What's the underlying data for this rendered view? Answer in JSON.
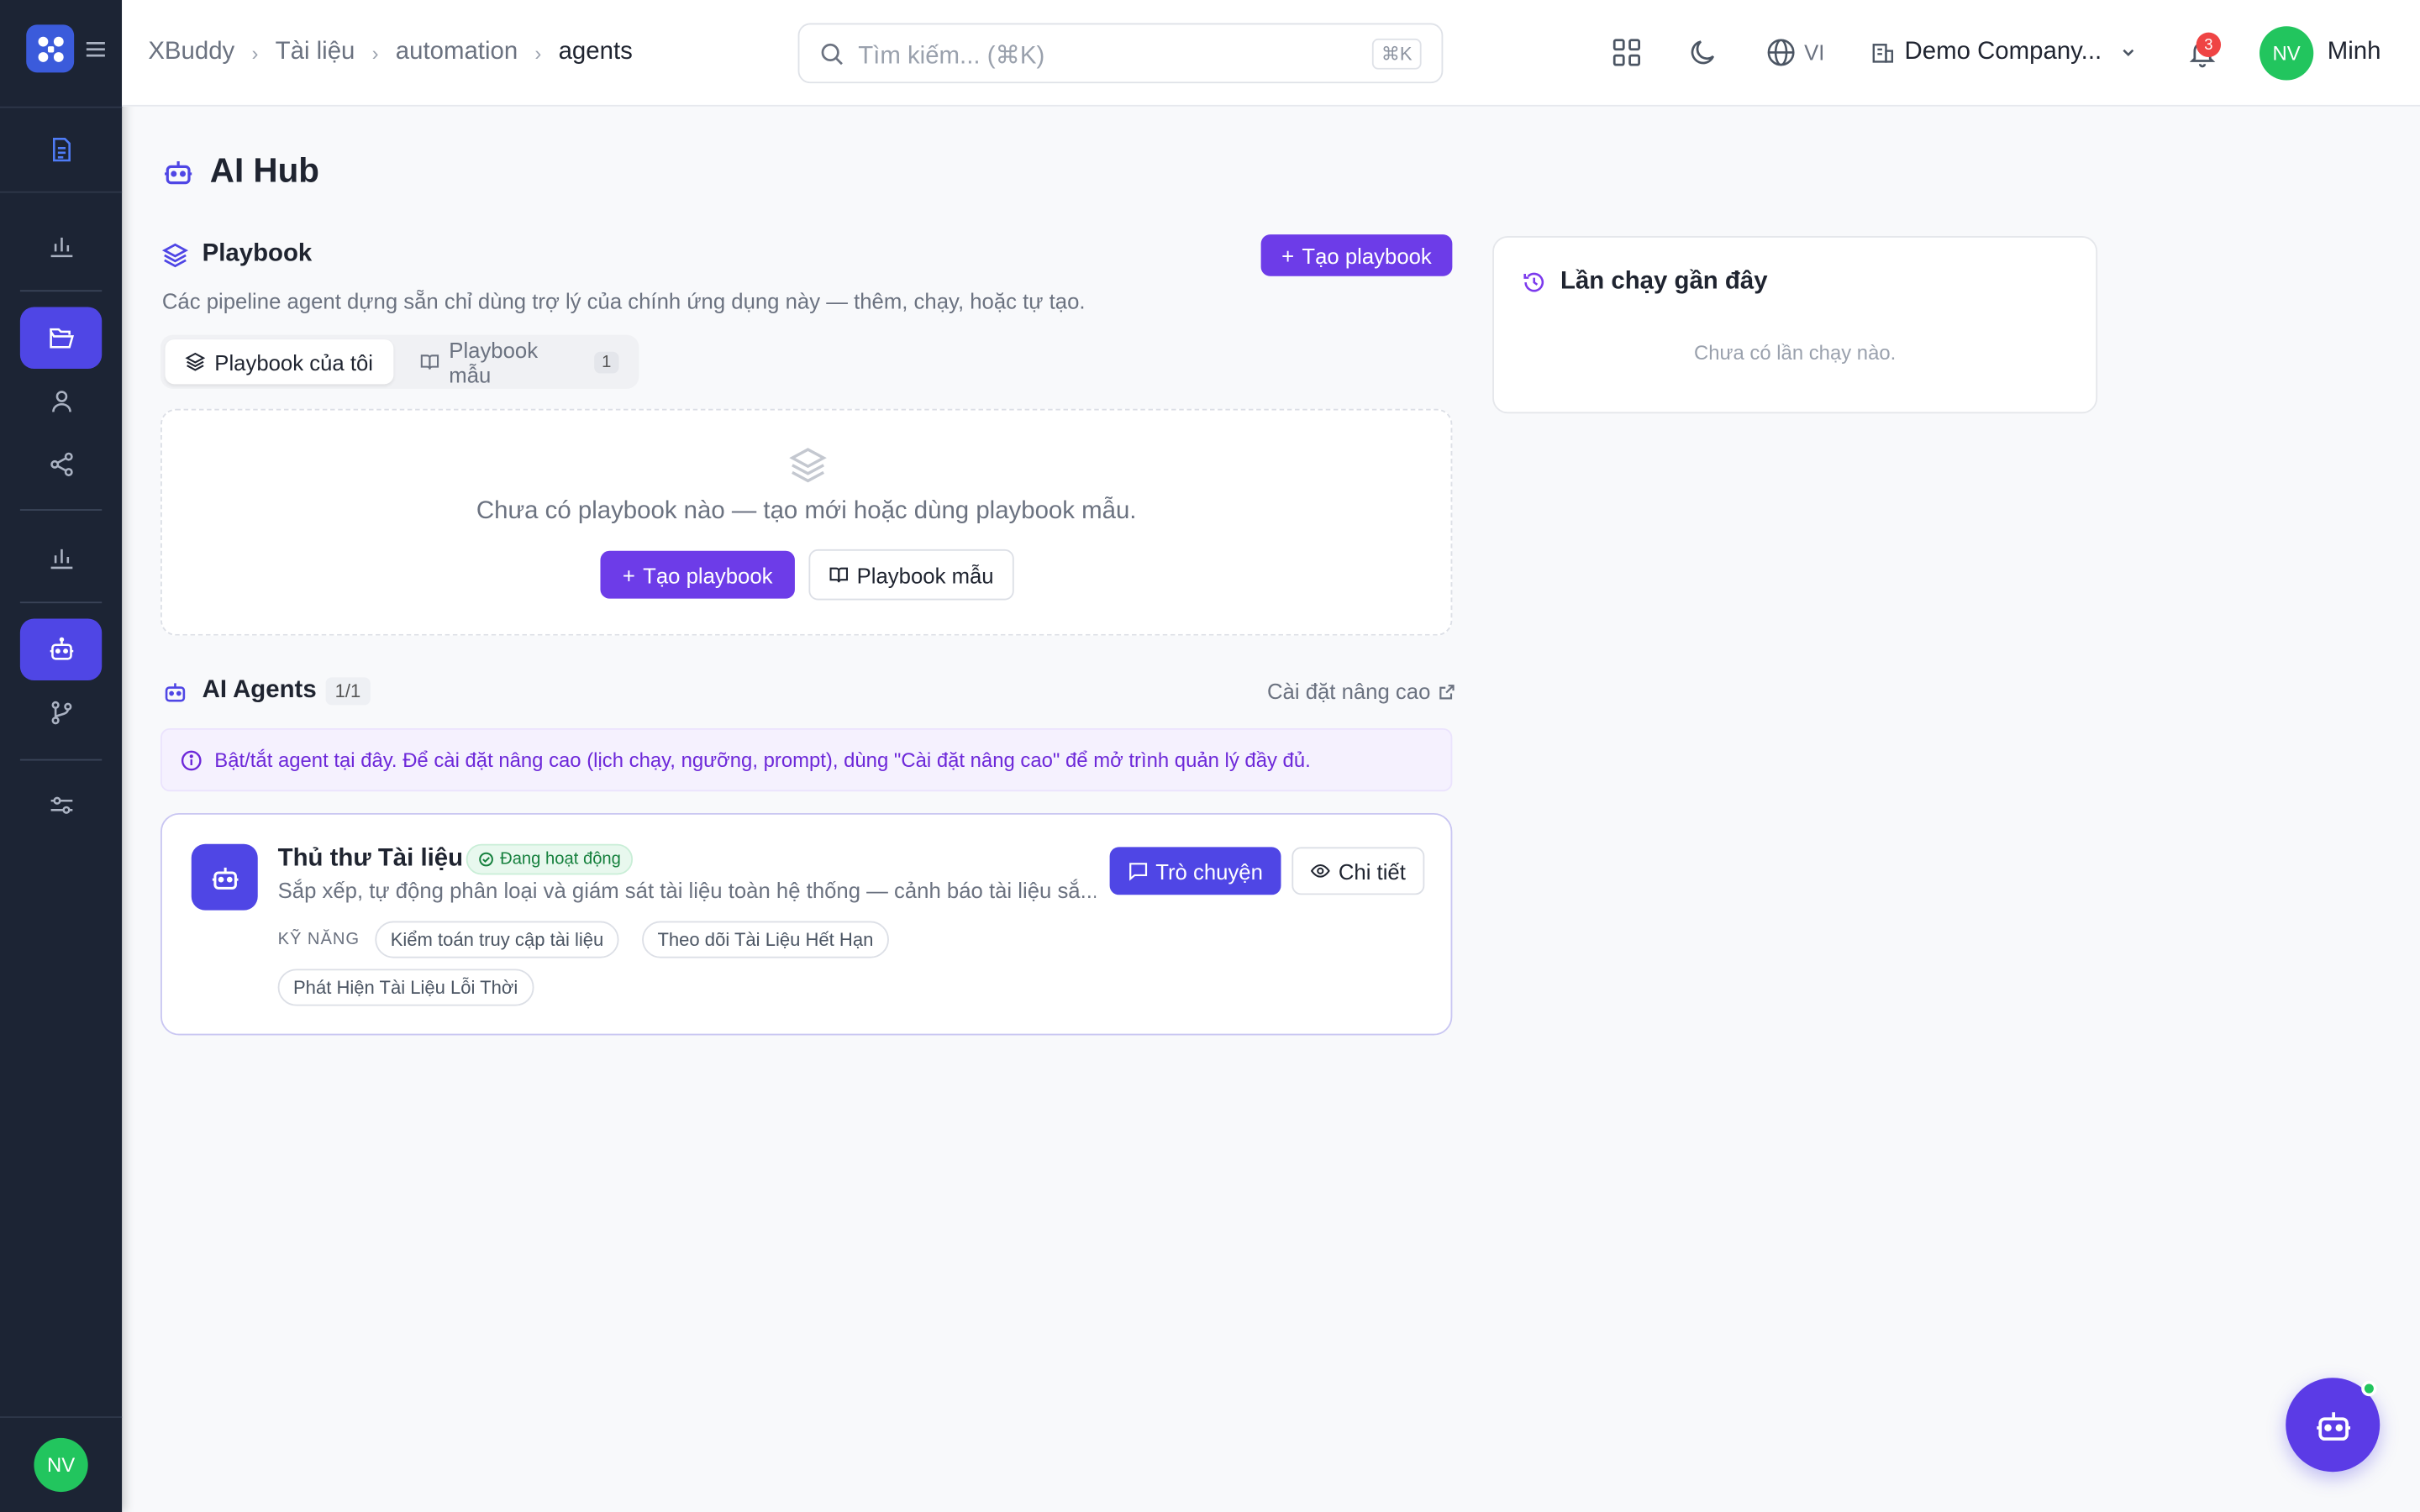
{
  "colors": {
    "sidebar": "#1c2434",
    "accent": "#4f46e5",
    "primary_button": "#6d3ce8",
    "success": "#22c55e",
    "danger": "#ef4444"
  },
  "sidebar": {
    "logo_icon": "xbuddy-logo-icon",
    "menu_icon": "hamburger-menu-icon",
    "items": [
      {
        "icon": "document-icon",
        "active": false
      },
      {
        "icon": "bar-chart-icon",
        "active": false
      },
      {
        "icon": "folder-open-icon",
        "active": true
      },
      {
        "icon": "user-icon",
        "active": false
      },
      {
        "icon": "share-icon",
        "active": false
      },
      {
        "icon": "bar-chart-icon",
        "active": false
      },
      {
        "icon": "robot-icon",
        "active": true
      },
      {
        "icon": "git-branch-icon",
        "active": false
      },
      {
        "icon": "sliders-icon",
        "active": false
      }
    ],
    "user_initials": "NV"
  },
  "header": {
    "breadcrumb": [
      "XBuddy",
      "Tài liệu",
      "automation",
      "agents"
    ],
    "search": {
      "placeholder": "Tìm kiếm... (⌘K)",
      "shortcut": "⌘K"
    },
    "language": "VI",
    "company": "Demo Company...",
    "notification_count": "3",
    "user_initials": "NV",
    "user_name": "Minh"
  },
  "page": {
    "title": "AI Hub"
  },
  "playbook": {
    "title": "Playbook",
    "create_label": "Tạo playbook",
    "description": "Các pipeline agent dựng sẵn chỉ dùng trợ lý của chính ứng dụng này — thêm, chạy, hoặc tự tạo.",
    "tabs": [
      {
        "label": "Playbook của tôi",
        "active": true
      },
      {
        "label": "Playbook mẫu",
        "count": "1",
        "active": false
      }
    ],
    "empty_message": "Chưa có playbook nào — tạo mới hoặc dùng playbook mẫu.",
    "empty_create_label": "Tạo playbook",
    "empty_template_label": "Playbook mẫu"
  },
  "agents": {
    "title": "AI Agents",
    "count": "1/1",
    "advanced_link": "Cài đặt nâng cao",
    "info": "Bật/tắt agent tại đây. Để cài đặt nâng cao (lịch chạy, ngưỡng, prompt), dùng \"Cài đặt nâng cao\" để mở trình quản lý đầy đủ.",
    "items": [
      {
        "name": "Thủ thư Tài liệu",
        "status": "Đang hoạt động",
        "description": "Sắp xếp, tự động phân loại và giám sát tài liệu toàn hệ thống — cảnh báo tài liệu sắ...",
        "skills_label": "KỸ NĂNG",
        "skills": [
          "Kiểm toán truy cập tài liệu",
          "Theo dõi Tài Liệu Hết Hạn",
          "Phát Hiện Tài Liệu Lỗi Thời"
        ],
        "chat_label": "Trò chuyện",
        "detail_label": "Chi tiết"
      }
    ]
  },
  "recent_runs": {
    "title": "Lần chạy gần đây",
    "empty": "Chưa có lần chạy nào."
  },
  "fab": {
    "icon": "robot-icon",
    "online": true
  }
}
